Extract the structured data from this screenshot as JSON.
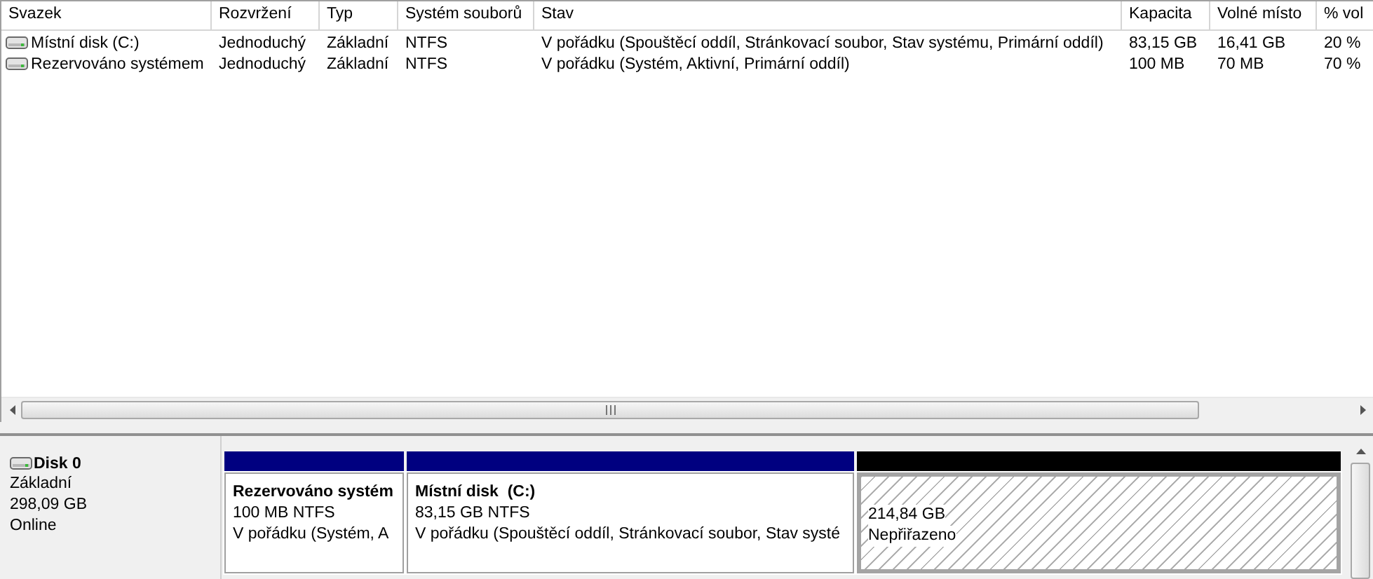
{
  "volume_list": {
    "columns": [
      "Svazek",
      "Rozvržení",
      "Typ",
      "Systém souborů",
      "Stav",
      "Kapacita",
      "Volné místo",
      "% vol"
    ],
    "rows": [
      {
        "cells": [
          "Místní disk (C:)",
          "Jednoduchý",
          "Základní",
          "NTFS",
          "V pořádku (Spouštěcí oddíl, Stránkovací soubor, Stav systému, Primární oddíl)",
          "83,15 GB",
          "16,41 GB",
          "20 %"
        ]
      },
      {
        "cells": [
          "Rezervováno systémem",
          "Jednoduchý",
          "Základní",
          "NTFS",
          "V pořádku (Systém, Aktivní, Primární oddíl)",
          "100 MB",
          "70 MB",
          "70 %"
        ]
      }
    ]
  },
  "disks": [
    {
      "name": "Disk 0",
      "type": "Základní",
      "size": "298,09 GB",
      "status": "Online",
      "partitions": [
        {
          "kind": "primary",
          "color": "#000080",
          "name": "Rezervováno systém",
          "size": "100 MB NTFS",
          "status": "V pořádku (Systém, A"
        },
        {
          "kind": "primary",
          "color": "#000080",
          "name": "Místní disk  (C:)",
          "size": "83,15 GB NTFS",
          "status": "V pořádku (Spouštěcí oddíl, Stránkovací soubor, Stav systé"
        },
        {
          "kind": "unallocated",
          "color": "#000000",
          "size": "214,84 GB",
          "status": "Nepřiřazeno"
        }
      ]
    }
  ]
}
